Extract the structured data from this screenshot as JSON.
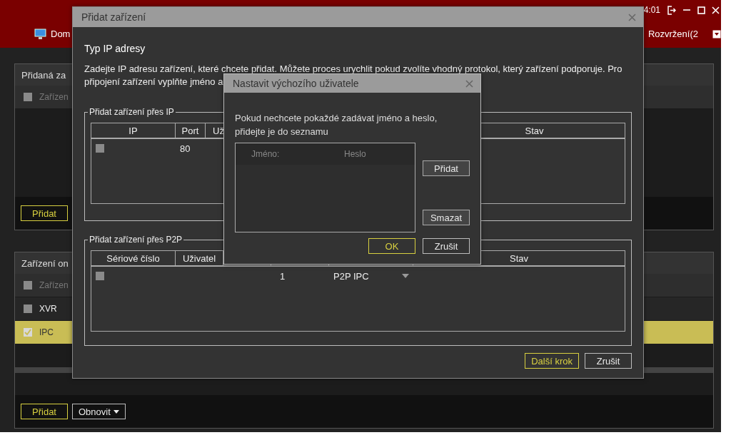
{
  "app": {
    "time": "4:01",
    "menu": [
      {
        "label": "Dom"
      }
    ],
    "layout_menu": "Rozvržení(2"
  },
  "added_panel": {
    "title": "Přidaná za",
    "header_checkbox": {
      "label": "Zařízen",
      "checked": false
    },
    "add_button": "Přidat"
  },
  "online_panel": {
    "title": "Zařízení on",
    "header_checkbox": {
      "label": "Zařízen",
      "checked": false
    },
    "rows": [
      {
        "label": "XVR",
        "checked": false,
        "selected": false
      },
      {
        "label": "IPC",
        "checked": true,
        "selected": true
      }
    ],
    "add_button": "Přidat",
    "refresh_button": "Obnovit"
  },
  "add_dialog": {
    "title": "Přidat zařízení",
    "heading": "Typ IP adresy",
    "description_lines": [
      "Zadejte IP adresu zařízení, které chcete přidat. Můžete proces urychlit pokud zvolíte vhodný protokol, který zařízení podporuje. Pro",
      "připojení zařízení vyplňte jméno a"
    ],
    "ip_group": {
      "title": "Přidat zařízení přes IP",
      "columns": [
        "IP",
        "Port",
        "Už",
        "Stav"
      ],
      "rows": [
        {
          "checked": false,
          "port": "80"
        }
      ]
    },
    "p2p_group": {
      "title": "Přidat zařízení přes P2P",
      "columns": [
        "Sériové číslo",
        "Uživatel",
        "Stav"
      ],
      "rows": [
        {
          "checked": false,
          "column_4": "1",
          "column_5": "P2P IPC"
        }
      ]
    },
    "buttons": [
      {
        "label": "Další krok",
        "primary": true
      },
      {
        "label": "Zrušit",
        "primary": false
      }
    ]
  },
  "user_dialog": {
    "title": "Nastavit výchozího uživatele",
    "text": "Pokud nechcete pokaždé zadávat jméno a heslo, přidejte je do seznamu",
    "columns": [
      "Jméno:",
      "Heslo"
    ],
    "side_buttons": [
      "Přidat",
      "Smazat"
    ],
    "buttons": [
      {
        "label": "OK",
        "primary": true
      },
      {
        "label": "Zrušit",
        "primary": false
      }
    ]
  }
}
